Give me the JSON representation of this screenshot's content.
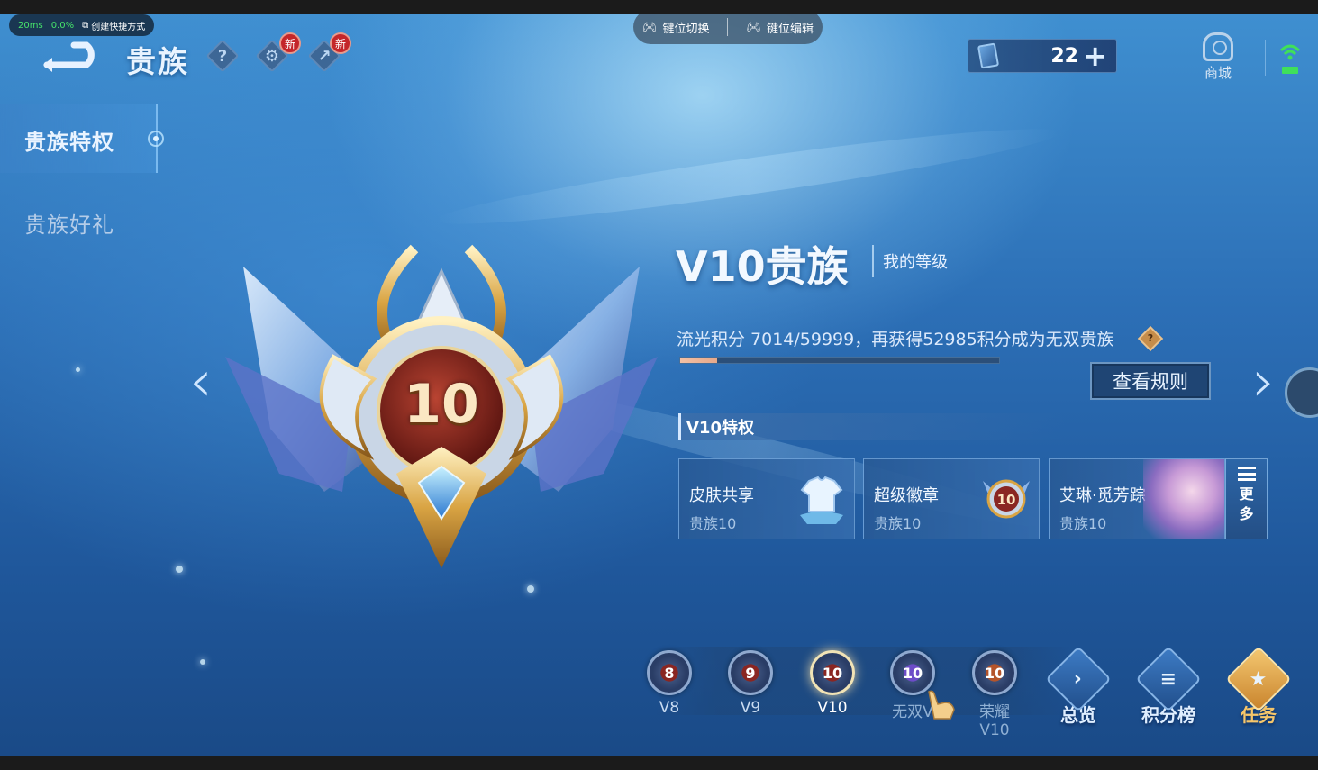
{
  "overlay": {
    "latency": "20ms",
    "loss": "0.0%",
    "shortcut_label": "创建快捷方式",
    "key_switch": "键位切换",
    "key_edit": "键位编辑"
  },
  "header": {
    "title": "贵族",
    "help_glyph": "?",
    "new_badge": "新",
    "currency_value": "22",
    "currency_plus": "+",
    "shop_label": "商城"
  },
  "sidebar": {
    "items": [
      {
        "label": "贵族特权",
        "active": true
      },
      {
        "label": "贵族好礼",
        "active": false
      }
    ]
  },
  "badge": {
    "level_number": "10"
  },
  "info": {
    "level_title": "V10贵族",
    "my_level": "我的等级",
    "points_text": "流光积分 7014/59999，再获得52985积分成为无双贵族",
    "points_current": 7014,
    "points_max": 59999,
    "rules_button": "查看规则",
    "help_mark": "?"
  },
  "privileges": {
    "header": "V10特权",
    "cards": [
      {
        "title": "皮肤共享",
        "sub": "贵族10",
        "icon": "shirt-icon"
      },
      {
        "title": "超级徽章",
        "sub": "贵族10",
        "icon": "badge-icon"
      },
      {
        "title": "艾琳·觅芳踪",
        "sub": "贵族10",
        "icon": "hero-portrait"
      }
    ],
    "more_l1": "更",
    "more_l2": "多"
  },
  "tiers": [
    {
      "label": "V8",
      "num": "8"
    },
    {
      "label": "V9",
      "num": "9"
    },
    {
      "label": "V10",
      "num": "10",
      "selected": true
    },
    {
      "label": "无双V",
      "num": "10"
    },
    {
      "label": "荣耀V10",
      "num": "10"
    }
  ],
  "bottom_nav": [
    {
      "label": "总览",
      "glyph": "›"
    },
    {
      "label": "积分榜",
      "glyph": "≡"
    },
    {
      "label": "任务",
      "glyph": "★"
    }
  ],
  "colors": {
    "accent_gold": "#f6c66a",
    "progress_fill": "#f3c0a4",
    "new_badge_red": "#c4262a"
  }
}
